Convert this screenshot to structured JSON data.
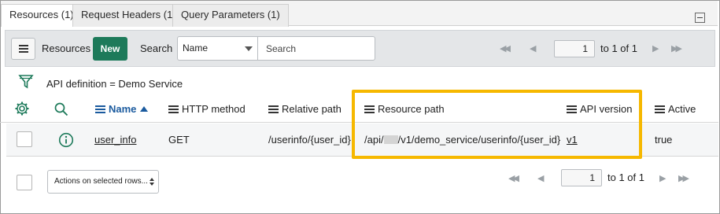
{
  "tabs": [
    {
      "label": "Resources (1)"
    },
    {
      "label": "Request Headers (1)"
    },
    {
      "label": "Query Parameters (1)"
    }
  ],
  "toolbar": {
    "resources_label": "Resources",
    "new_label": "New",
    "search_label": "Search",
    "search_field_selected": "Name",
    "search_placeholder": "Search",
    "page_value": "1",
    "page_range": "to 1 of 1"
  },
  "filter": {
    "text": "API definition = Demo Service"
  },
  "table": {
    "columns": [
      {
        "label": "Name",
        "sorted": "ascending"
      },
      {
        "label": "HTTP method"
      },
      {
        "label": "Relative path"
      },
      {
        "label": "Resource path"
      },
      {
        "label": "API version"
      },
      {
        "label": "Active"
      }
    ],
    "rows": [
      {
        "name": "user_info",
        "http_method": "GET",
        "relative_path": "/userinfo/{user_id}",
        "resource_path_prefix": "/api/",
        "resource_path_suffix": "/v1/demo_service/userinfo/{user_id}",
        "api_version": "v1",
        "active": "true"
      }
    ]
  },
  "footer": {
    "actions_label": "Actions on selected rows...",
    "page_value": "1",
    "page_range": "to 1 of 1"
  },
  "colors": {
    "new_button": "#1d7a5a",
    "sort_link": "#1a5a9e",
    "highlight": "#f6b800",
    "toolbar_bg": "#e4e6e8"
  },
  "icons": [
    "hamburger-icon",
    "funnel-filter-icon",
    "gear-icon",
    "search-icon",
    "info-icon",
    "first-page-icon",
    "prev-page-icon",
    "next-page-icon",
    "last-page-icon",
    "collapse-icon",
    "sort-ascending-icon"
  ]
}
